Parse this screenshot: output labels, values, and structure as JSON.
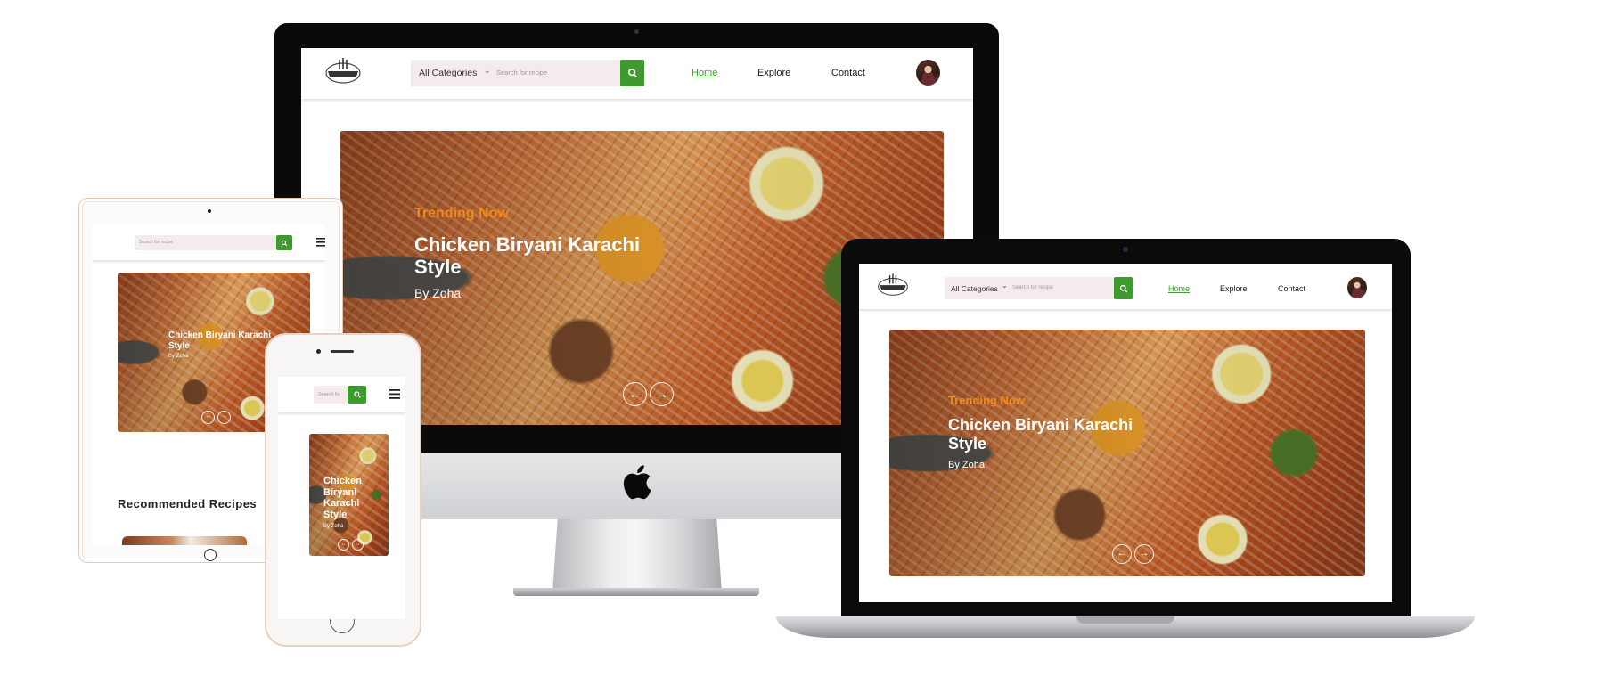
{
  "site": {
    "category_label": "All Categories",
    "search_placeholder": "Search for recipe",
    "nav": {
      "home": "Home",
      "explore": "Explore",
      "contact": "Contact"
    },
    "hero": {
      "kicker": "Trending Now",
      "title": "Chicken Biryani Karachi Style",
      "author": "By Zoha"
    },
    "recommended_heading": "Recommended Recipes"
  },
  "tablet": {
    "search_placeholder": "Search for recipe"
  },
  "phone": {
    "search_placeholder": "Search fo"
  },
  "colors": {
    "accent": "#3e9a2e",
    "kicker": "#f08a1c",
    "search_bg": "#f4ecec"
  },
  "icons": {
    "search": "search-icon",
    "menu": "hamburger-menu-icon",
    "arrows": [
      "arrow-left-icon",
      "arrow-right-icon"
    ],
    "brand": "apple-logo-icon"
  }
}
